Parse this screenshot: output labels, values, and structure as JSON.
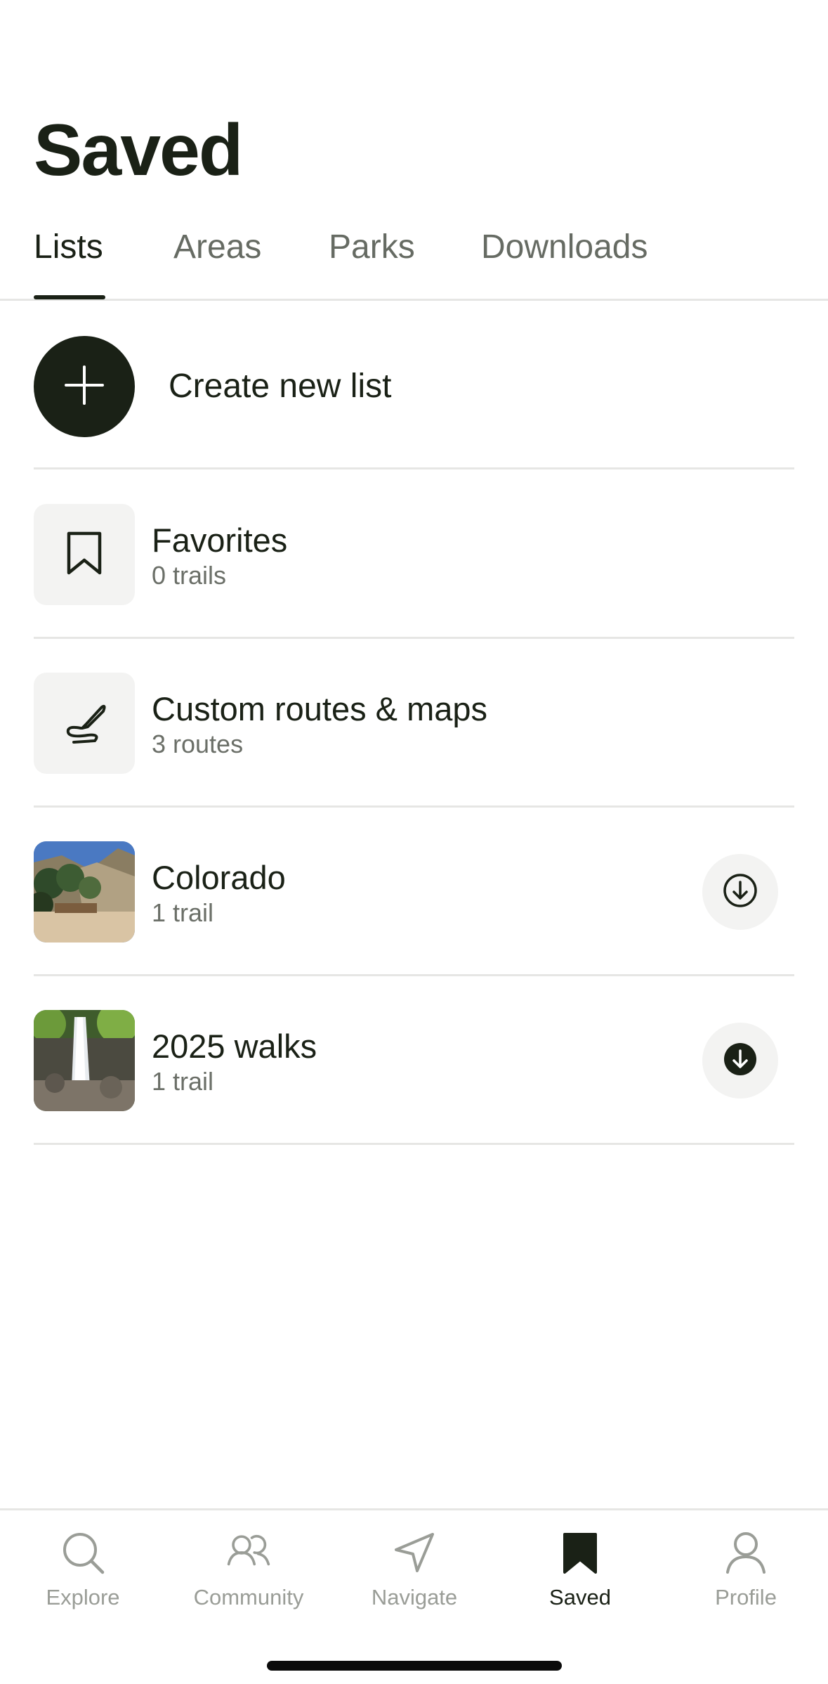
{
  "page": {
    "title": "Saved"
  },
  "tabs": [
    {
      "label": "Lists",
      "active": true
    },
    {
      "label": "Areas",
      "active": false
    },
    {
      "label": "Parks",
      "active": false
    },
    {
      "label": "Downloads",
      "active": false
    }
  ],
  "create": {
    "label": "Create new list",
    "icon": "plus-icon"
  },
  "lists": [
    {
      "title": "Favorites",
      "subtitle": "0 trails",
      "icon": "bookmark-icon"
    },
    {
      "title": "Custom routes & maps",
      "subtitle": "3 routes",
      "icon": "pen-route-icon"
    },
    {
      "title": "Colorado",
      "subtitle": "1 trail",
      "thumbnail": "mountain-trail-photo",
      "download_icon": "download-outline-icon"
    },
    {
      "title": "2025 walks",
      "subtitle": "1 trail",
      "thumbnail": "waterfall-photo",
      "download_icon": "download-filled-icon"
    }
  ],
  "nav": [
    {
      "label": "Explore",
      "icon": "search-icon",
      "active": false
    },
    {
      "label": "Community",
      "icon": "people-icon",
      "active": false
    },
    {
      "label": "Navigate",
      "icon": "navigate-arrow-icon",
      "active": false
    },
    {
      "label": "Saved",
      "icon": "bookmark-filled-icon",
      "active": true
    },
    {
      "label": "Profile",
      "icon": "person-icon",
      "active": false
    }
  ],
  "colors": {
    "primary": "#1a2116",
    "muted_text": "#6b6f68",
    "divider": "#e6e6e4",
    "tile_bg": "#f3f3f2",
    "nav_inactive": "#9a9d97"
  }
}
